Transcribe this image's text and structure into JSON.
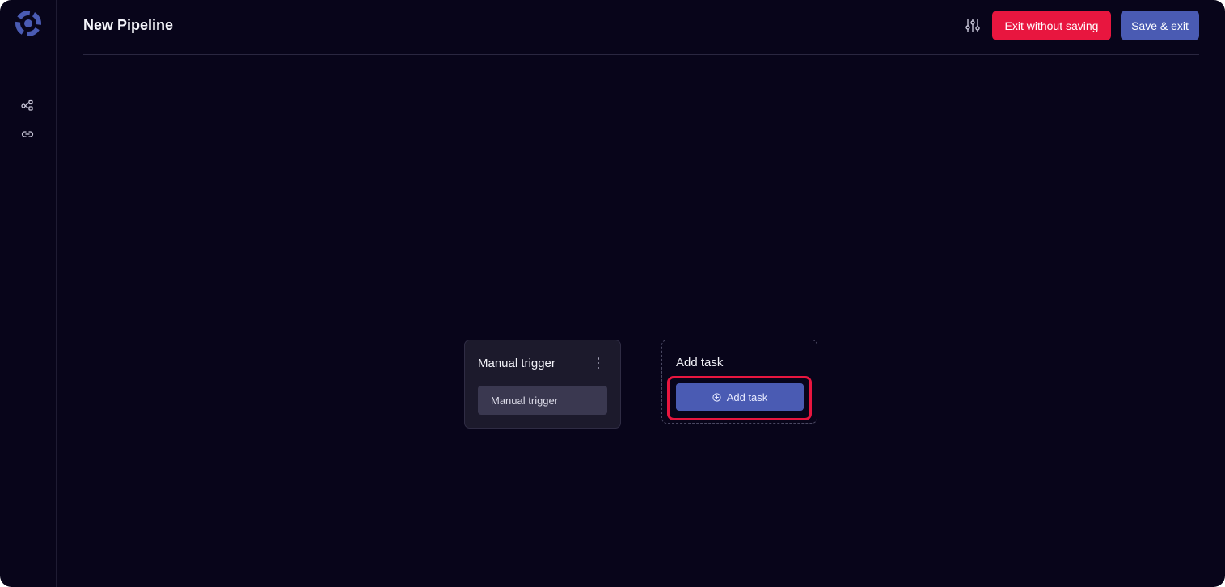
{
  "header": {
    "title": "New Pipeline",
    "exit_label": "Exit without saving",
    "save_label": "Save & exit"
  },
  "sidebar": {
    "items": [
      {
        "icon": "workflow-icon"
      },
      {
        "icon": "link-icon"
      }
    ]
  },
  "canvas": {
    "trigger_node": {
      "title": "Manual trigger",
      "pill_label": "Manual trigger"
    },
    "add_node": {
      "title": "Add task",
      "button_label": "Add task"
    }
  },
  "colors": {
    "background": "#08051a",
    "danger": "#e8163f",
    "primary": "#4a5bb3",
    "node_bg": "#1c1a2c"
  }
}
